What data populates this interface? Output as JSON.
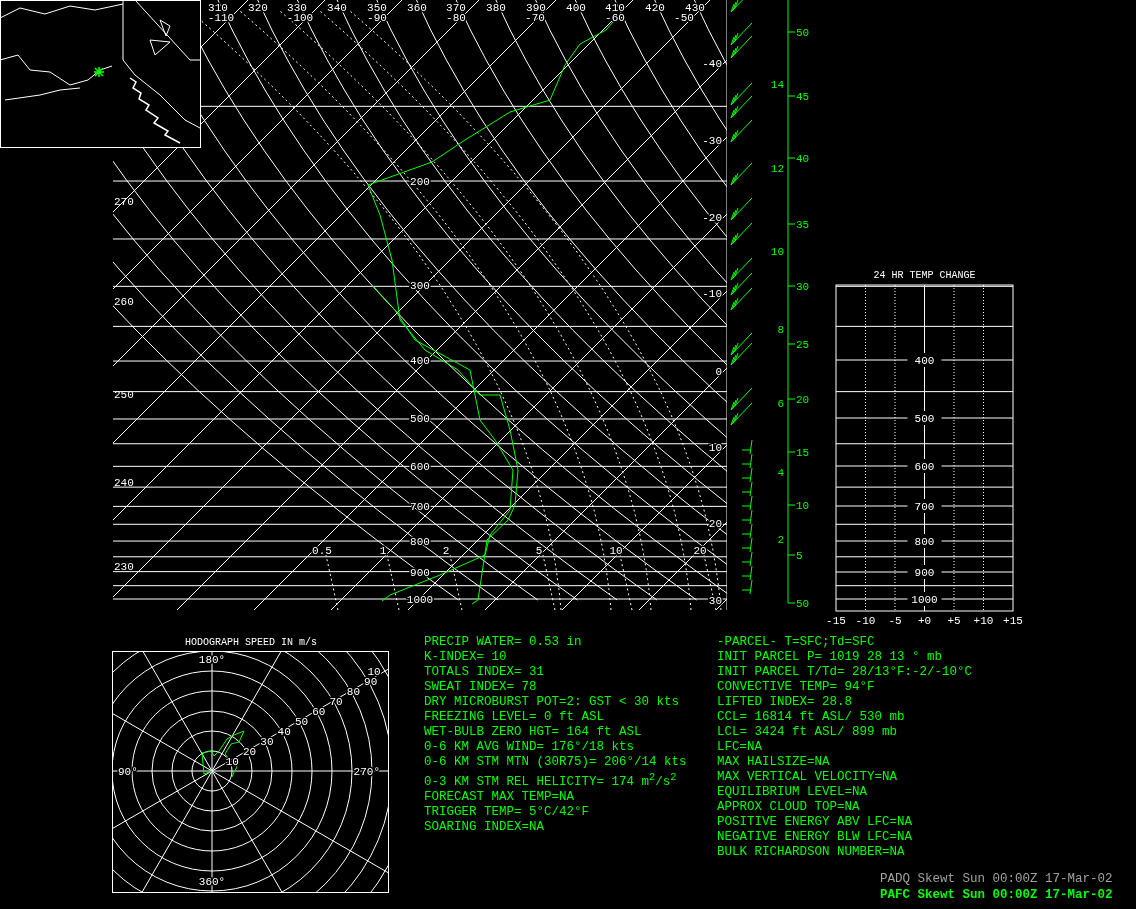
{
  "skewt": {
    "theta_labels": [
      "310",
      "320",
      "330",
      "340",
      "350",
      "360",
      "370",
      "380",
      "390",
      "400",
      "410",
      "420",
      "430"
    ],
    "top_temp_labels": [
      "-110",
      "-100",
      "-90",
      "-80",
      "-70",
      "-60",
      "-50"
    ],
    "isotherm_labels": [
      "-40",
      "-30",
      "-20",
      "-10",
      "0",
      "10",
      "20",
      "30"
    ],
    "left_labels": [
      "270",
      "260",
      "250",
      "240",
      "230"
    ],
    "pressure_labels": [
      "200",
      "300",
      "400",
      "500",
      "600",
      "700",
      "800",
      "900",
      "1000"
    ],
    "mixing_ratio_labels": [
      "0.5",
      "1",
      "2",
      "5",
      "10",
      "20"
    ]
  },
  "height_axis": {
    "km_labels": [
      "14",
      "12",
      "10",
      "8",
      "6",
      "4",
      "2"
    ],
    "kft_labels": [
      "50",
      "45",
      "40",
      "35",
      "30",
      "25",
      "20",
      "15",
      "10",
      "5",
      "50"
    ]
  },
  "temp_change": {
    "title": "24 HR TEMP CHANGE",
    "pressure_labels": [
      "400",
      "500",
      "600",
      "700",
      "800",
      "900",
      "1000"
    ],
    "x_labels": [
      "-15",
      "-10",
      "-5",
      "+0",
      "+5",
      "+10",
      "+15"
    ]
  },
  "hodograph": {
    "title": "HODOGRAPH SPEED IN m/s",
    "direction_labels": [
      "180°",
      "90°",
      "270°",
      "360°"
    ],
    "speed_labels": [
      "10",
      "20",
      "30",
      "40",
      "50",
      "60",
      "70",
      "80",
      "90",
      "10"
    ]
  },
  "indices_left": [
    "PRECIP WATER= 0.53 in",
    "K-INDEX= 10",
    "TOTALS INDEX= 31",
    "SWEAT INDEX= 78",
    "DRY MICROBURST POT=2: GST < 30 kts",
    "FREEZING LEVEL= 0 ft ASL",
    "WET-BULB ZERO HGT= 164 ft ASL",
    "0-6 KM AVG WIND= 176°/18 kts",
    "0-6 KM STM MTN (30R75)= 206°/14 kts",
    "0-3 KM STM REL HELICITY= 174 m$^{2}$/s$^{2}$",
    "FORECAST MAX TEMP=NA",
    "TRIGGER TEMP= 5°C/42°F",
    "SOARING INDEX=NA"
  ],
  "indices_right": [
    "-PARCEL- T=SFC;Td=SFC",
    "INIT PARCEL P= 1019 28 13 ° mb",
    "INIT PARCEL T/Td= 28/13°F:-2/-10°C",
    "CONVECTIVE TEMP= 94°F",
    "LIFTED INDEX= 28.8",
    "CCL= 16814 ft ASL/ 530 mb",
    "LCL= 3424 ft ASL/ 899 mb",
    "LFC=NA",
    "MAX HAILSIZE=NA",
    "MAX VERTICAL VELOCITY=NA",
    "EQUILIBRIUM LEVEL=NA",
    "APPROX CLOUD TOP=NA",
    "POSITIVE ENERGY ABV LFC=NA",
    "NEGATIVE ENERGY BLW LFC=NA",
    "BULK RICHARDSON NUMBER=NA"
  ],
  "footer": [
    {
      "text": "PADQ Skewt Sun 00:00Z 17-Mar-02",
      "active": false
    },
    {
      "text": "PAFC Skewt Sun 00:00Z 17-Mar-02",
      "active": true
    }
  ]
}
